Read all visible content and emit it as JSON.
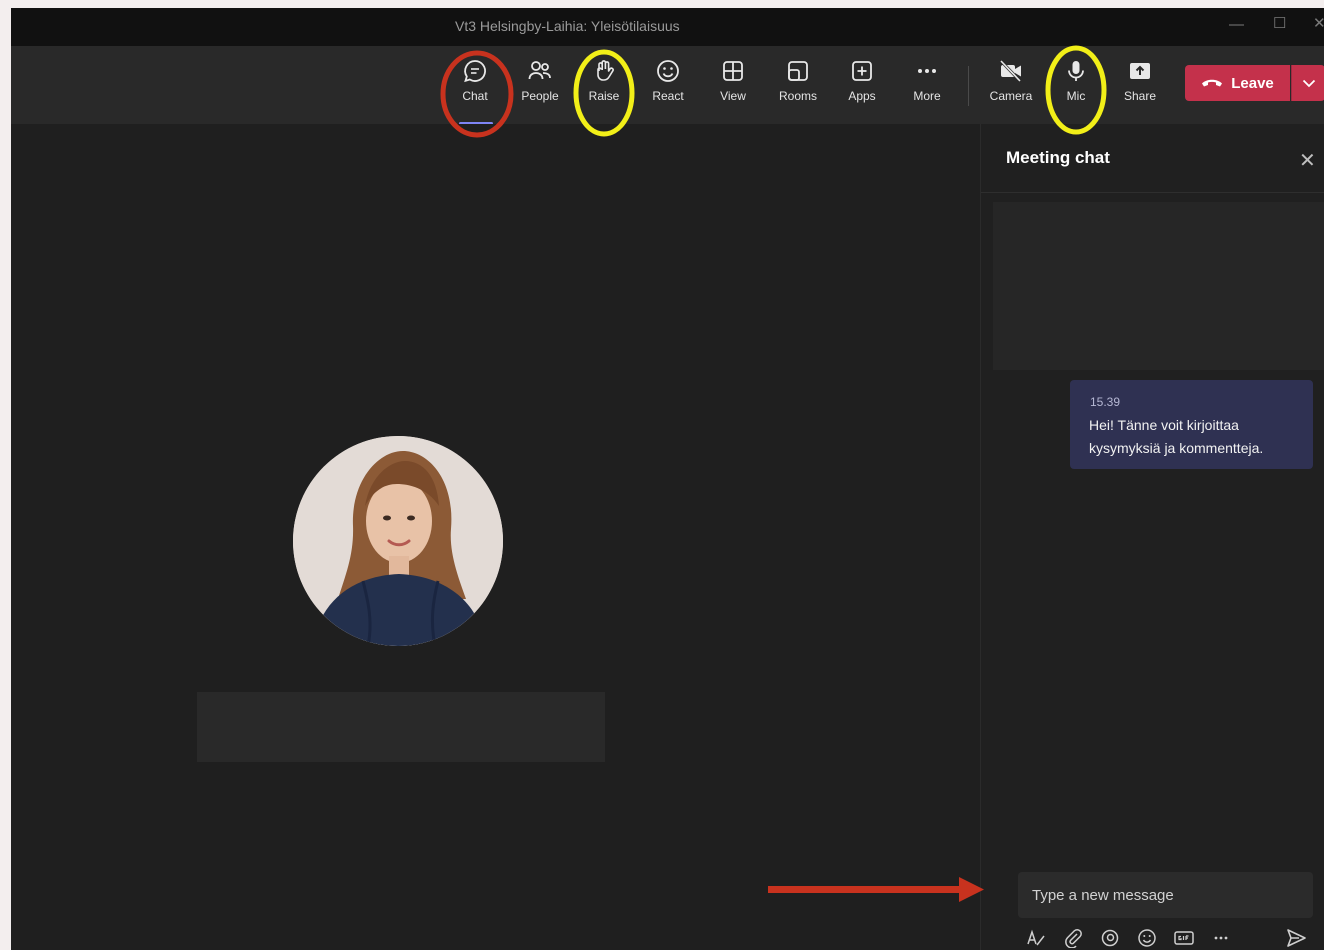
{
  "window": {
    "title": "Vt3 Helsingby-Laihia: Yleisötilaisuus"
  },
  "toolbar": {
    "items": [
      {
        "label": "Chat",
        "icon": "chat-icon"
      },
      {
        "label": "People",
        "icon": "people-icon"
      },
      {
        "label": "Raise",
        "icon": "raise-hand-icon"
      },
      {
        "label": "React",
        "icon": "react-smiley-icon"
      },
      {
        "label": "View",
        "icon": "view-grid-icon"
      },
      {
        "label": "Rooms",
        "icon": "rooms-icon"
      },
      {
        "label": "Apps",
        "icon": "apps-plus-icon"
      },
      {
        "label": "More",
        "icon": "more-dots-icon"
      },
      {
        "label": "Camera",
        "icon": "camera-off-icon"
      },
      {
        "label": "Mic",
        "icon": "mic-icon"
      },
      {
        "label": "Share",
        "icon": "share-icon"
      }
    ],
    "leave_label": "Leave"
  },
  "chat": {
    "title": "Meeting chat",
    "messages": [
      {
        "time": "15.39",
        "text": "Hei! Tänne voit kirjoittaa kysymyksiä ja kommentteja."
      }
    ],
    "compose_placeholder": "Type a new message"
  },
  "colors": {
    "leave": "#c4314b",
    "annotation_red": "#c8321e",
    "annotation_yellow": "#f2ef18",
    "active_tab": "#7f85f5"
  }
}
